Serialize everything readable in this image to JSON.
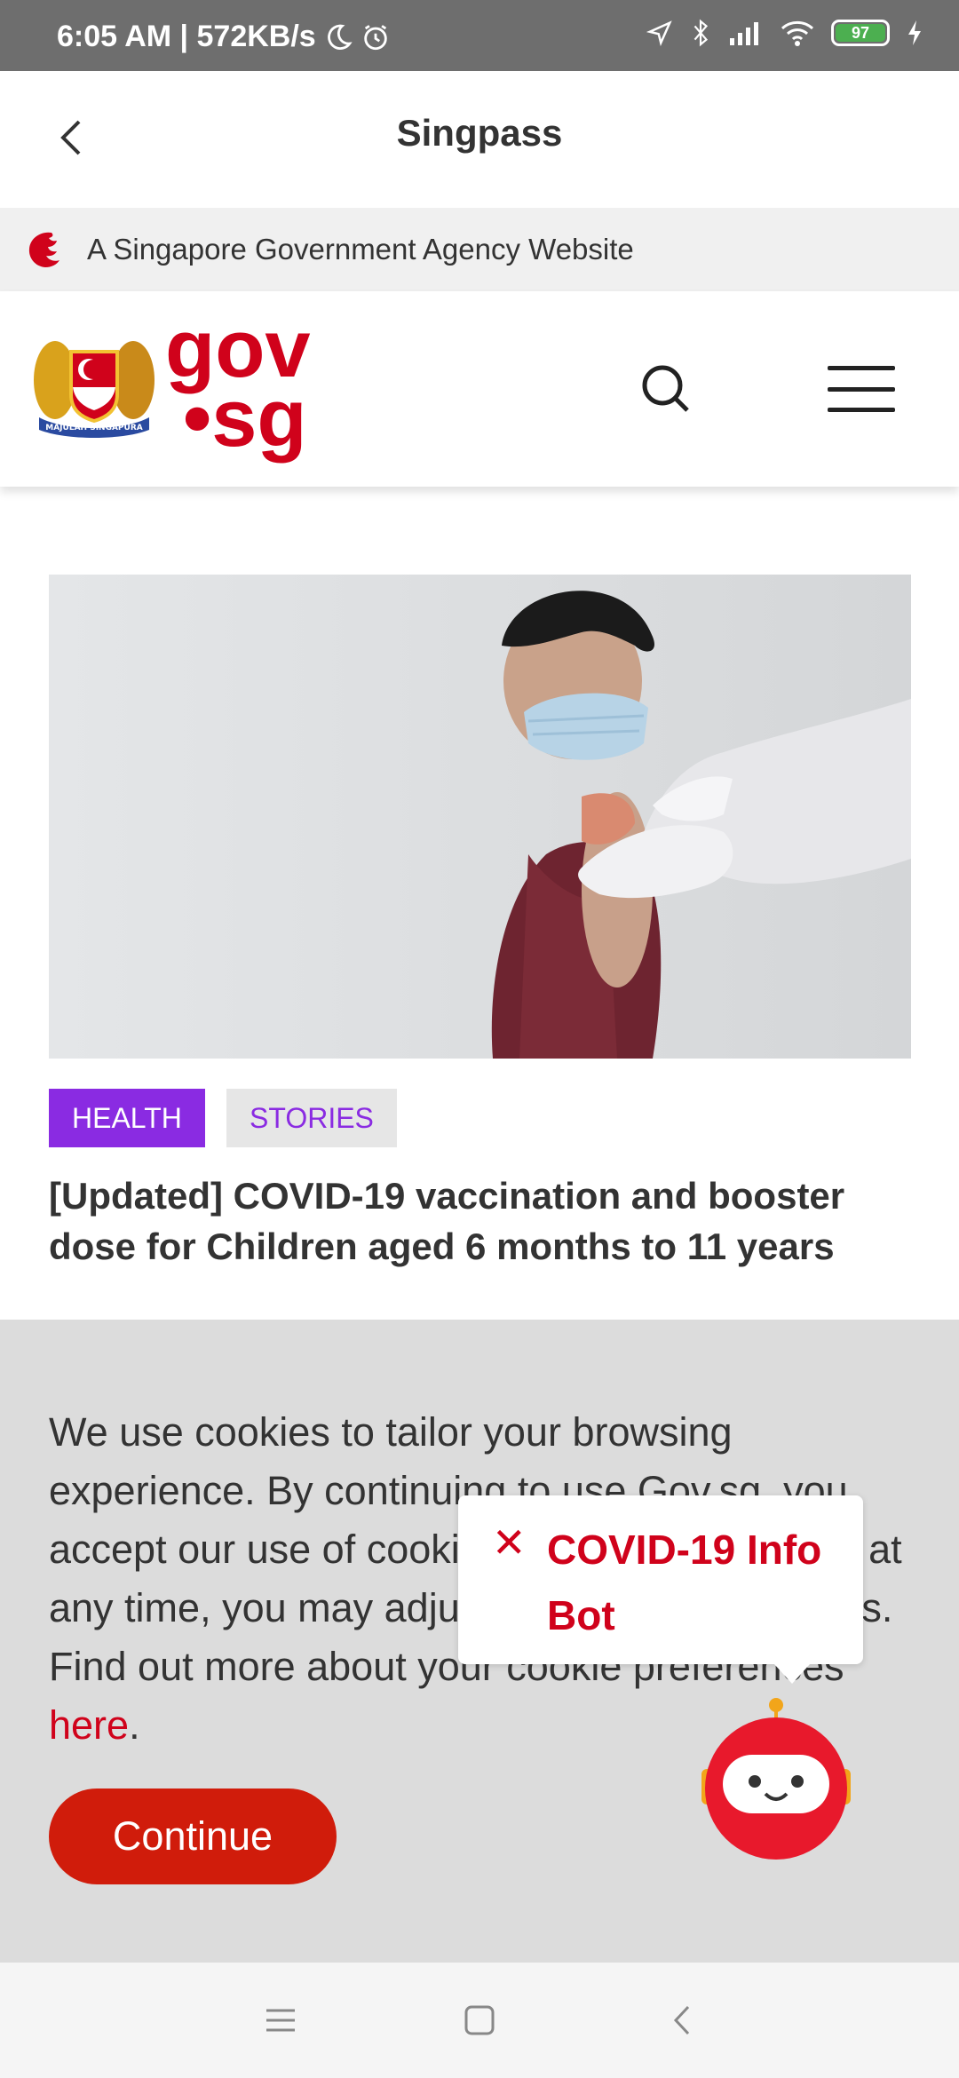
{
  "status_bar": {
    "time_speed": "6:05 AM | 572KB/s",
    "battery": "97"
  },
  "app_header": {
    "title": "Singpass"
  },
  "gov_banner": {
    "text": "A Singapore Government Agency Website"
  },
  "site_header": {
    "logo_line1": "gov",
    "logo_line2": "•sg",
    "crest_motto": "MAJULAH SINGAPURA"
  },
  "article": {
    "tags": [
      "HEALTH",
      "STORIES"
    ],
    "title": "[Updated] COVID-19 vaccination and booster dose for Children aged 6 months to 11 years"
  },
  "cookie_banner": {
    "text_before_link": "We use cookies to tailor your browsing experience. By continuing to use Gov.sg, you accept our use of cookies. If you do not agree at any time, you may adjust your browser settings. Find out more about your cookie preferences ",
    "link_text": "here",
    "text_after_link": ".",
    "continue_label": "Continue"
  },
  "bot_popup": {
    "close_symbol": "✕",
    "title": "COVID-19 Info Bot"
  },
  "colors": {
    "brand_red": "#d0021b",
    "tag_purple": "#8a2be2",
    "status_bar": "#6e6e6e",
    "cookie_bg": "#dcdcdc"
  }
}
